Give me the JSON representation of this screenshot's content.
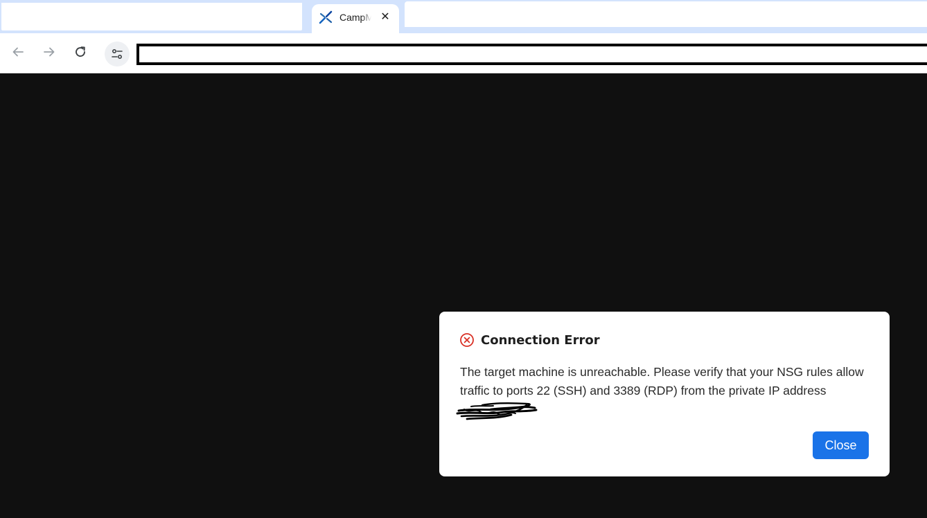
{
  "browser": {
    "active_tab": {
      "title": "CampM",
      "favicon": "campm-logo-icon"
    },
    "address_bar": {
      "value": ""
    },
    "icons": {
      "back": "arrow-left-icon",
      "forward": "arrow-right-icon",
      "reload": "reload-icon",
      "site_settings": "tune-icon",
      "close_tab": "close-icon"
    }
  },
  "dialog": {
    "icon": "error-circle-icon",
    "title": "Connection Error",
    "message": "The target machine is unreachable. Please verify that your NSG rules allow traffic to ports 22 (SSH) and 3389 (RDP) from the private IP address",
    "close_label": "Close"
  },
  "colors": {
    "page_background": "#101010",
    "tabstrip": "#d3e3fd",
    "primary_button": "#1a73e8",
    "error": "#d93025"
  }
}
